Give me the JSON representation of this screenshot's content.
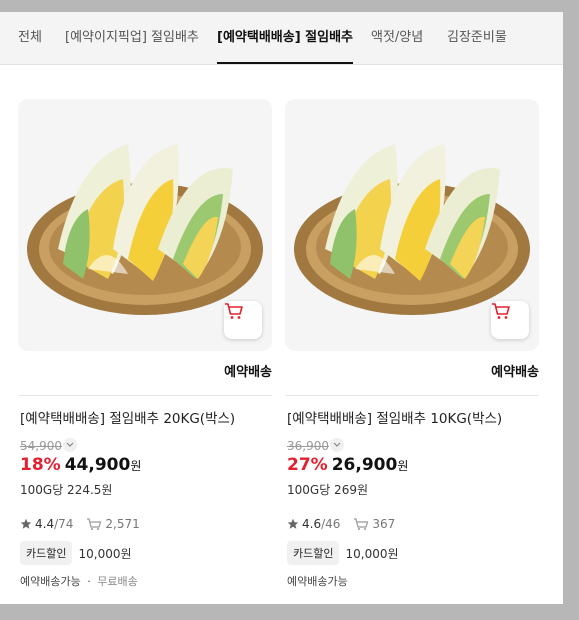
{
  "tabs": [
    {
      "label": "전체",
      "active": false
    },
    {
      "label": "[예약이지픽업] 절임배추",
      "active": false
    },
    {
      "label": "[예약택배배송] 절임배추",
      "active": true
    },
    {
      "label": "액젓/양념",
      "active": false
    },
    {
      "label": "김장준비물",
      "active": false
    }
  ],
  "products": [
    {
      "delivery_label": "예약배송",
      "title": "[예약택배배송] 절임배추 20KG(박스)",
      "original_price": "54,900",
      "discount": "18%",
      "price": "44,900",
      "currency": "원",
      "unit_price": "100G당 224.5원",
      "rating": "4.4",
      "review_count": "/74",
      "cart_count": "2,571",
      "card_badge": "카드할인",
      "card_discount": "10,000원",
      "availability": "예약배송가능",
      "separator": "·",
      "shipping": "무료배송"
    },
    {
      "delivery_label": "예약배송",
      "title": "[예약택배배송] 절임배추 10KG(박스)",
      "original_price": "36,900",
      "discount": "27%",
      "price": "26,900",
      "currency": "원",
      "unit_price": "100G당 269원",
      "rating": "4.6",
      "review_count": "/46",
      "cart_count": "367",
      "card_badge": "카드할인",
      "card_discount": "10,000원",
      "availability": "예약배송가능"
    }
  ],
  "colors": {
    "accent_red": "#e3202f",
    "cart_icon": "#e3202f",
    "backdrop": "#b7b7b7"
  },
  "icons": [
    "cart-icon",
    "star-icon",
    "cart-count-icon",
    "chevron-down-icon"
  ]
}
